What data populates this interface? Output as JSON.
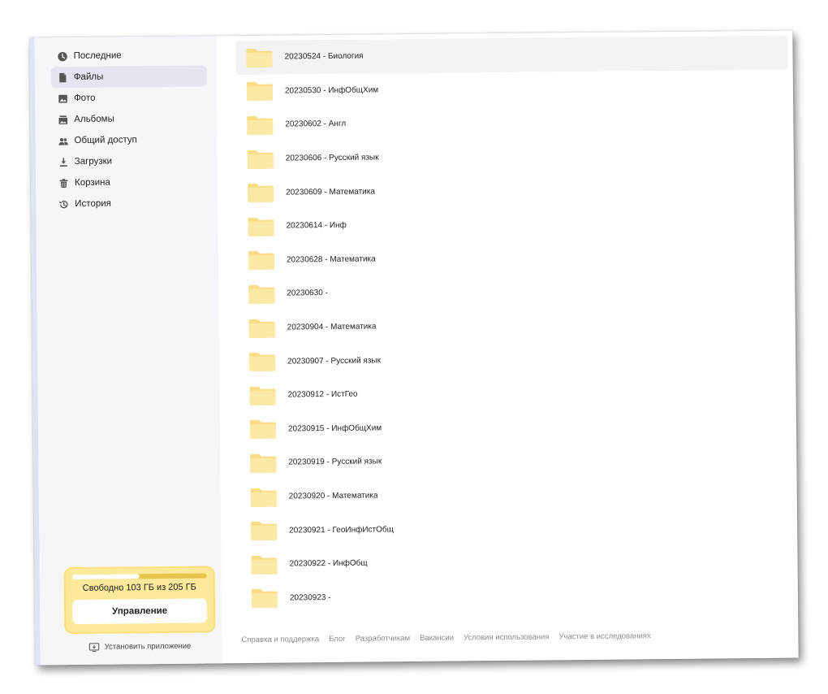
{
  "sidebar": {
    "items": [
      {
        "label": "Последние",
        "icon": "clock-icon"
      },
      {
        "label": "Файлы",
        "icon": "file-icon",
        "active": true
      },
      {
        "label": "Фото",
        "icon": "photo-icon"
      },
      {
        "label": "Альбомы",
        "icon": "albums-icon"
      },
      {
        "label": "Общий доступ",
        "icon": "users-icon"
      },
      {
        "label": "Загрузки",
        "icon": "download-icon"
      },
      {
        "label": "Корзина",
        "icon": "trash-icon"
      },
      {
        "label": "История",
        "icon": "history-icon"
      }
    ]
  },
  "storage": {
    "text": "Свободно 103 ГБ из 205 ГБ",
    "used_fraction": 0.5,
    "manage_label": "Управление",
    "install_label": "Установить приложение"
  },
  "files": [
    {
      "name": "20230524 - Биология",
      "icon": "folder-icon"
    },
    {
      "name": "20230530 - ИнфОбщХим",
      "icon": "folder-icon"
    },
    {
      "name": "20230602 - Англ",
      "icon": "folder-icon"
    },
    {
      "name": "20230606 - Русский язык",
      "icon": "folder-icon"
    },
    {
      "name": "20230609 - Математика",
      "icon": "folder-icon"
    },
    {
      "name": "20230614 - Инф",
      "icon": "folder-icon"
    },
    {
      "name": "20230628 - Математика",
      "icon": "folder-icon"
    },
    {
      "name": "20230630 -",
      "icon": "folder-icon"
    },
    {
      "name": "20230904 - Математика",
      "icon": "folder-icon"
    },
    {
      "name": "20230907 - Русский язык",
      "icon": "folder-icon"
    },
    {
      "name": "20230912 - ИстГео",
      "icon": "folder-icon"
    },
    {
      "name": "20230915 - ИнфОбщХим",
      "icon": "folder-icon"
    },
    {
      "name": "20230919 - Русский язык",
      "icon": "folder-icon"
    },
    {
      "name": "20230920 - Математика",
      "icon": "folder-icon"
    },
    {
      "name": "20230921 - ГеоИнфИстОбщ",
      "icon": "folder-icon"
    },
    {
      "name": "20230922 - ИнфОбщ",
      "icon": "folder-icon"
    },
    {
      "name": "20230923 -",
      "icon": "folder-icon"
    }
  ],
  "footer": {
    "links": [
      "Справка и поддержка",
      "Блог",
      "Разработчикам",
      "Вакансии",
      "Условия использования",
      "Участие в исследованиях"
    ]
  },
  "colors": {
    "folder": "#fde9a6",
    "folder_tab": "#f9dd87",
    "storage_bg": "#fce99a",
    "sidebar_bg": "#f5f6fa",
    "active_item": "#e3e6ee"
  }
}
